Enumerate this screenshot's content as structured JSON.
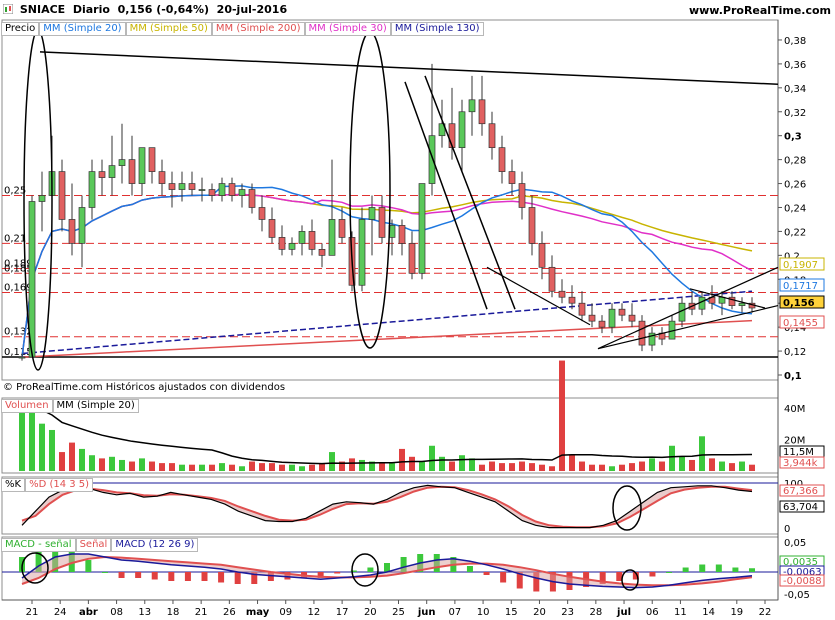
{
  "header": {
    "symbol": "SNIACE",
    "period": "Diario",
    "price_change": "0,156 (-0,64%)",
    "date": "20-jul-2016",
    "site": "www.ProRealTime.com"
  },
  "price_legend": [
    {
      "label": "Precio",
      "color": "#000000"
    },
    {
      "label": "MM (Simple 20)",
      "color": "#1e78e0"
    },
    {
      "label": "MM (Simple 50)",
      "color": "#c8b400"
    },
    {
      "label": "MM (Simple 200)",
      "color": "#e05050"
    },
    {
      "label": "MM (Simple 30)",
      "color": "#e030c8"
    },
    {
      "label": "MM (Simple 130)",
      "color": "#1a1a9a"
    }
  ],
  "copyright": "© ProRealTime.com  Históricos ajustados con dividendos",
  "volume_legend": [
    {
      "label": "Volumen",
      "color": "#e05050"
    },
    {
      "label": "MM (Simple 20)",
      "color": "#000000"
    }
  ],
  "stoch_legend": [
    {
      "label": "%K",
      "color": "#000000"
    },
    {
      "label": "%D (14 3 5)",
      "color": "#e05050"
    }
  ],
  "macd_legend": [
    {
      "label": "MACD - señal",
      "color": "#30b030"
    },
    {
      "label": "Señal",
      "color": "#e05050"
    },
    {
      "label": "MACD (12 26 9)",
      "color": "#1a1a9a"
    }
  ],
  "x_labels": [
    "21",
    "24",
    "abr",
    "08",
    "13",
    "18",
    "21",
    "26",
    "may",
    "09",
    "12",
    "17",
    "20",
    "25",
    "jun",
    "07",
    "10",
    "15",
    "20",
    "23",
    "28",
    "jul",
    "06",
    "11",
    "14",
    "19",
    "22"
  ],
  "price_axis": {
    "ticks": [
      "0,38",
      "0,36",
      "0,34",
      "0,32",
      "0,3",
      "0,28",
      "0,26",
      "0,24",
      "0,22",
      "0,2",
      "0,18",
      "0,16",
      "0,14",
      "0,12",
      "0,1"
    ],
    "left_levels": [
      "0,25",
      "0,21",
      "0,189",
      "0,185",
      "0,169",
      "0,132",
      "0,115"
    ],
    "badges": [
      {
        "text": "0,1907",
        "color": "#c8b400"
      },
      {
        "text": "0,1717",
        "color": "#1e78e0"
      },
      {
        "text": "0,156",
        "color": "#000000"
      },
      {
        "text": "0,1455",
        "color": "#e05050"
      }
    ]
  },
  "volume_axis": {
    "ticks": [
      "40M",
      "20M"
    ],
    "badges": [
      {
        "text": "11,5M",
        "color": "#000000"
      },
      {
        "text": "3,944k",
        "color": "#e05050"
      }
    ]
  },
  "stoch_axis": {
    "ticks": [
      "100",
      "0"
    ],
    "badges": [
      {
        "text": "67,366",
        "color": "#e05050"
      },
      {
        "text": "63,704",
        "color": "#000000"
      }
    ]
  },
  "macd_axis": {
    "ticks": [
      "0,05",
      "-0,05"
    ],
    "badges": [
      {
        "text": "0,0035",
        "color": "#30b030"
      },
      {
        "text": "-0,0063",
        "color": "#1a1a9a"
      },
      {
        "text": "-0,0088",
        "color": "#e05050"
      }
    ]
  },
  "chart_data": {
    "type": "candlestick",
    "title": "SNIACE Diario",
    "ylim": [
      0.1,
      0.39
    ],
    "candles": [
      [
        0.115,
        0.118,
        0.112,
        0.115
      ],
      [
        0.115,
        0.25,
        0.115,
        0.245
      ],
      [
        0.245,
        0.27,
        0.22,
        0.25
      ],
      [
        0.25,
        0.3,
        0.23,
        0.27
      ],
      [
        0.27,
        0.28,
        0.22,
        0.23
      ],
      [
        0.23,
        0.26,
        0.2,
        0.21
      ],
      [
        0.21,
        0.25,
        0.19,
        0.24
      ],
      [
        0.24,
        0.28,
        0.23,
        0.27
      ],
      [
        0.27,
        0.28,
        0.25,
        0.265
      ],
      [
        0.265,
        0.3,
        0.25,
        0.275
      ],
      [
        0.275,
        0.31,
        0.26,
        0.28
      ],
      [
        0.28,
        0.3,
        0.25,
        0.26
      ],
      [
        0.26,
        0.29,
        0.25,
        0.29
      ],
      [
        0.29,
        0.29,
        0.26,
        0.27
      ],
      [
        0.27,
        0.28,
        0.25,
        0.26
      ],
      [
        0.26,
        0.27,
        0.24,
        0.255
      ],
      [
        0.255,
        0.27,
        0.245,
        0.26
      ],
      [
        0.26,
        0.27,
        0.25,
        0.255
      ],
      [
        0.255,
        0.265,
        0.245,
        0.255
      ],
      [
        0.255,
        0.26,
        0.245,
        0.25
      ],
      [
        0.25,
        0.265,
        0.245,
        0.26
      ],
      [
        0.26,
        0.265,
        0.245,
        0.25
      ],
      [
        0.25,
        0.26,
        0.24,
        0.255
      ],
      [
        0.255,
        0.26,
        0.235,
        0.24
      ],
      [
        0.24,
        0.25,
        0.22,
        0.23
      ],
      [
        0.23,
        0.24,
        0.21,
        0.215
      ],
      [
        0.215,
        0.225,
        0.2,
        0.205
      ],
      [
        0.205,
        0.215,
        0.2,
        0.21
      ],
      [
        0.21,
        0.225,
        0.2,
        0.22
      ],
      [
        0.22,
        0.23,
        0.2,
        0.205
      ],
      [
        0.205,
        0.21,
        0.19,
        0.2
      ],
      [
        0.2,
        0.28,
        0.2,
        0.23
      ],
      [
        0.23,
        0.24,
        0.21,
        0.215
      ],
      [
        0.215,
        0.22,
        0.17,
        0.175
      ],
      [
        0.175,
        0.24,
        0.17,
        0.23
      ],
      [
        0.23,
        0.25,
        0.2,
        0.24
      ],
      [
        0.24,
        0.25,
        0.21,
        0.215
      ],
      [
        0.215,
        0.23,
        0.2,
        0.225
      ],
      [
        0.225,
        0.23,
        0.2,
        0.21
      ],
      [
        0.21,
        0.22,
        0.18,
        0.185
      ],
      [
        0.185,
        0.26,
        0.18,
        0.26
      ],
      [
        0.26,
        0.36,
        0.25,
        0.3
      ],
      [
        0.3,
        0.33,
        0.29,
        0.31
      ],
      [
        0.31,
        0.34,
        0.28,
        0.29
      ],
      [
        0.29,
        0.33,
        0.27,
        0.32
      ],
      [
        0.32,
        0.35,
        0.3,
        0.33
      ],
      [
        0.33,
        0.35,
        0.3,
        0.31
      ],
      [
        0.31,
        0.32,
        0.28,
        0.29
      ],
      [
        0.29,
        0.3,
        0.26,
        0.27
      ],
      [
        0.27,
        0.28,
        0.25,
        0.26
      ],
      [
        0.26,
        0.27,
        0.23,
        0.24
      ],
      [
        0.24,
        0.25,
        0.2,
        0.21
      ],
      [
        0.21,
        0.22,
        0.18,
        0.19
      ],
      [
        0.19,
        0.2,
        0.165,
        0.17
      ],
      [
        0.17,
        0.18,
        0.16,
        0.165
      ],
      [
        0.165,
        0.175,
        0.155,
        0.16
      ],
      [
        0.16,
        0.17,
        0.145,
        0.15
      ],
      [
        0.15,
        0.16,
        0.14,
        0.145
      ],
      [
        0.145,
        0.15,
        0.135,
        0.14
      ],
      [
        0.14,
        0.16,
        0.135,
        0.155
      ],
      [
        0.155,
        0.16,
        0.145,
        0.15
      ],
      [
        0.15,
        0.16,
        0.14,
        0.145
      ],
      [
        0.145,
        0.15,
        0.12,
        0.125
      ],
      [
        0.125,
        0.14,
        0.12,
        0.135
      ],
      [
        0.135,
        0.14,
        0.125,
        0.13
      ],
      [
        0.13,
        0.15,
        0.13,
        0.145
      ],
      [
        0.145,
        0.165,
        0.14,
        0.16
      ],
      [
        0.16,
        0.17,
        0.15,
        0.155
      ],
      [
        0.155,
        0.17,
        0.15,
        0.165
      ],
      [
        0.165,
        0.175,
        0.155,
        0.16
      ],
      [
        0.16,
        0.17,
        0.15,
        0.165
      ],
      [
        0.165,
        0.17,
        0.155,
        0.158
      ],
      [
        0.158,
        0.165,
        0.152,
        0.16
      ],
      [
        0.16,
        0.165,
        0.152,
        0.156
      ]
    ],
    "volume": [
      42,
      44,
      30,
      26,
      12,
      18,
      14,
      10,
      8,
      9,
      7,
      6,
      8,
      6,
      5,
      5,
      4,
      4,
      4,
      4,
      5,
      4,
      3,
      6,
      5,
      5,
      4,
      4,
      3,
      4,
      5,
      12,
      6,
      8,
      7,
      6,
      5,
      5,
      14,
      9,
      6,
      16,
      9,
      6,
      10,
      8,
      4,
      6,
      5,
      5,
      6,
      5,
      4,
      3,
      70,
      10,
      6,
      4,
      4,
      3,
      4,
      5,
      6,
      8,
      6,
      16,
      9,
      7,
      22,
      8,
      6,
      5,
      6,
      4
    ],
    "stoch_k": [
      10,
      40,
      70,
      85,
      90,
      88,
      80,
      75,
      78,
      70,
      72,
      80,
      75,
      70,
      65,
      55,
      40,
      30,
      20,
      18,
      18,
      25,
      40,
      55,
      60,
      58,
      55,
      65,
      80,
      90,
      95,
      92,
      90,
      80,
      70,
      60,
      40,
      20,
      10,
      5,
      5,
      5,
      5,
      10,
      20,
      40,
      60,
      80,
      90,
      92,
      94,
      94,
      90,
      85,
      82
    ],
    "stoch_d": [
      20,
      30,
      55,
      75,
      85,
      88,
      85,
      80,
      78,
      74,
      73,
      76,
      75,
      72,
      68,
      62,
      50,
      40,
      30,
      22,
      20,
      22,
      32,
      45,
      55,
      57,
      56,
      60,
      70,
      82,
      90,
      92,
      91,
      85,
      76,
      65,
      50,
      32,
      18,
      10,
      7,
      6,
      6,
      8,
      14,
      28,
      45,
      62,
      78,
      86,
      90,
      92,
      92,
      88,
      85
    ],
    "macd": [
      -0.01,
      0.01,
      0.025,
      0.03,
      0.03,
      0.025,
      0.02,
      0.018,
      0.015,
      0.012,
      0.01,
      0.008,
      0.005,
      0.0,
      -0.004,
      -0.006,
      -0.008,
      -0.01,
      -0.012,
      -0.01,
      -0.008,
      -0.005,
      0.0,
      0.008,
      0.015,
      0.02,
      0.022,
      0.018,
      0.012,
      0.005,
      -0.003,
      -0.01,
      -0.016,
      -0.02,
      -0.022,
      -0.024,
      -0.025,
      -0.026,
      -0.025,
      -0.022,
      -0.018,
      -0.014,
      -0.011,
      -0.009,
      -0.0063
    ],
    "signal": [
      -0.02,
      -0.01,
      0.005,
      0.015,
      0.022,
      0.025,
      0.024,
      0.022,
      0.02,
      0.018,
      0.016,
      0.014,
      0.012,
      0.008,
      0.004,
      0.0,
      -0.003,
      -0.006,
      -0.008,
      -0.009,
      -0.009,
      -0.008,
      -0.006,
      -0.002,
      0.003,
      0.008,
      0.012,
      0.014,
      0.014,
      0.012,
      0.008,
      0.003,
      -0.003,
      -0.008,
      -0.012,
      -0.016,
      -0.019,
      -0.021,
      -0.022,
      -0.022,
      -0.021,
      -0.019,
      -0.016,
      -0.012,
      -0.0088
    ]
  }
}
